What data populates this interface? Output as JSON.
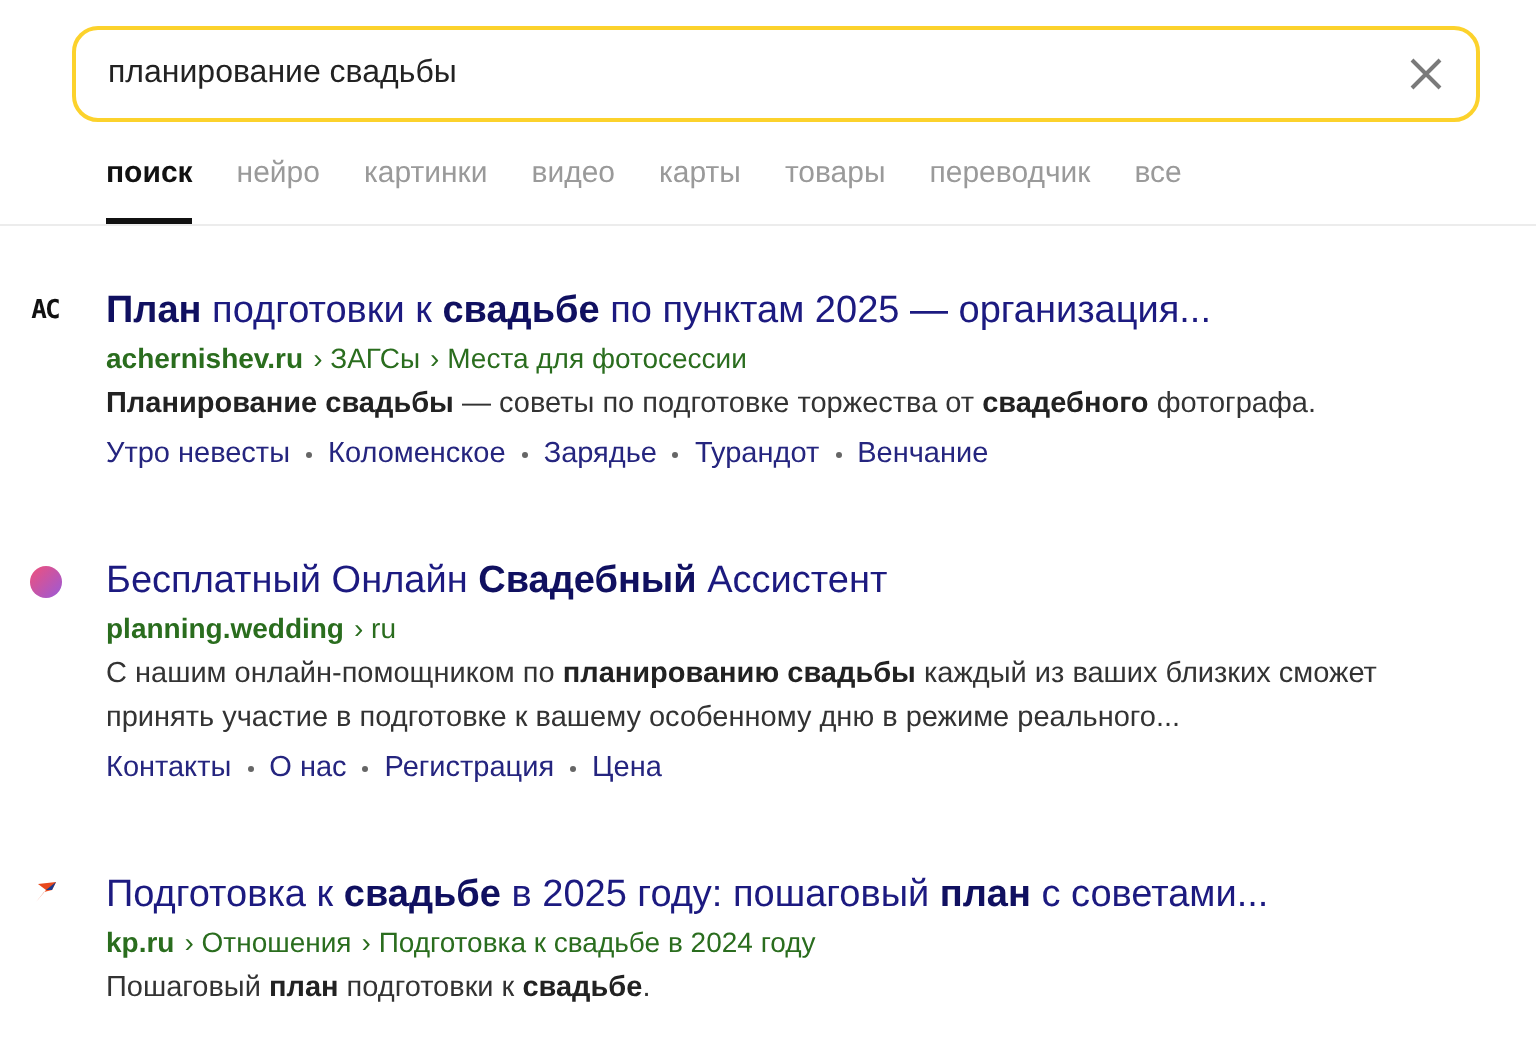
{
  "search": {
    "value": "планирование свадьбы"
  },
  "tabs": [
    {
      "label": "поиск",
      "selected": true
    },
    {
      "label": "нейро",
      "selected": false
    },
    {
      "label": "картинки",
      "selected": false
    },
    {
      "label": "видео",
      "selected": false
    },
    {
      "label": "карты",
      "selected": false
    },
    {
      "label": "товары",
      "selected": false
    },
    {
      "label": "переводчик",
      "selected": false
    },
    {
      "label": "все",
      "selected": false
    }
  ],
  "results": [
    {
      "favicon": {
        "kind": "letters",
        "text": "AC"
      },
      "title": "**План** подготовки к **свадьбе** по пунктам 2025 — организация...",
      "breadcrumbs": [
        "achernishev.ru",
        "› ЗАГСы",
        "› Места для фотосессии"
      ],
      "snippet": "**Планирование свадьбы** — советы по подготовке торжества от **свадебного** фотографа.",
      "sitelinks": [
        "Утро невесты",
        "Коломенское",
        "Зарядье",
        "Турандот",
        "Венчание"
      ]
    },
    {
      "favicon": {
        "kind": "dot"
      },
      "title": "Бесплатный Онлайн **Свадебный** Ассистент",
      "breadcrumbs": [
        "planning.wedding",
        "› ru"
      ],
      "snippet": "С нашим онлайн-помощником по **планированию свадьбы** каждый из ваших близких сможет принять участие в подготовке к вашему особенному дню в режиме реального...",
      "sitelinks": [
        "Контакты",
        "О нас",
        "Регистрация",
        "Цена"
      ]
    },
    {
      "favicon": {
        "kind": "star"
      },
      "title": "Подготовка к **свадьбе** в 2025 году: пошаговый **план** с советами...",
      "breadcrumbs": [
        "kp.ru",
        "› Отношения",
        "› Подготовка к свадьбе в 2024 году"
      ],
      "snippet": "Пошаговый **план** подготовки к **свадьбе**."
    }
  ]
}
